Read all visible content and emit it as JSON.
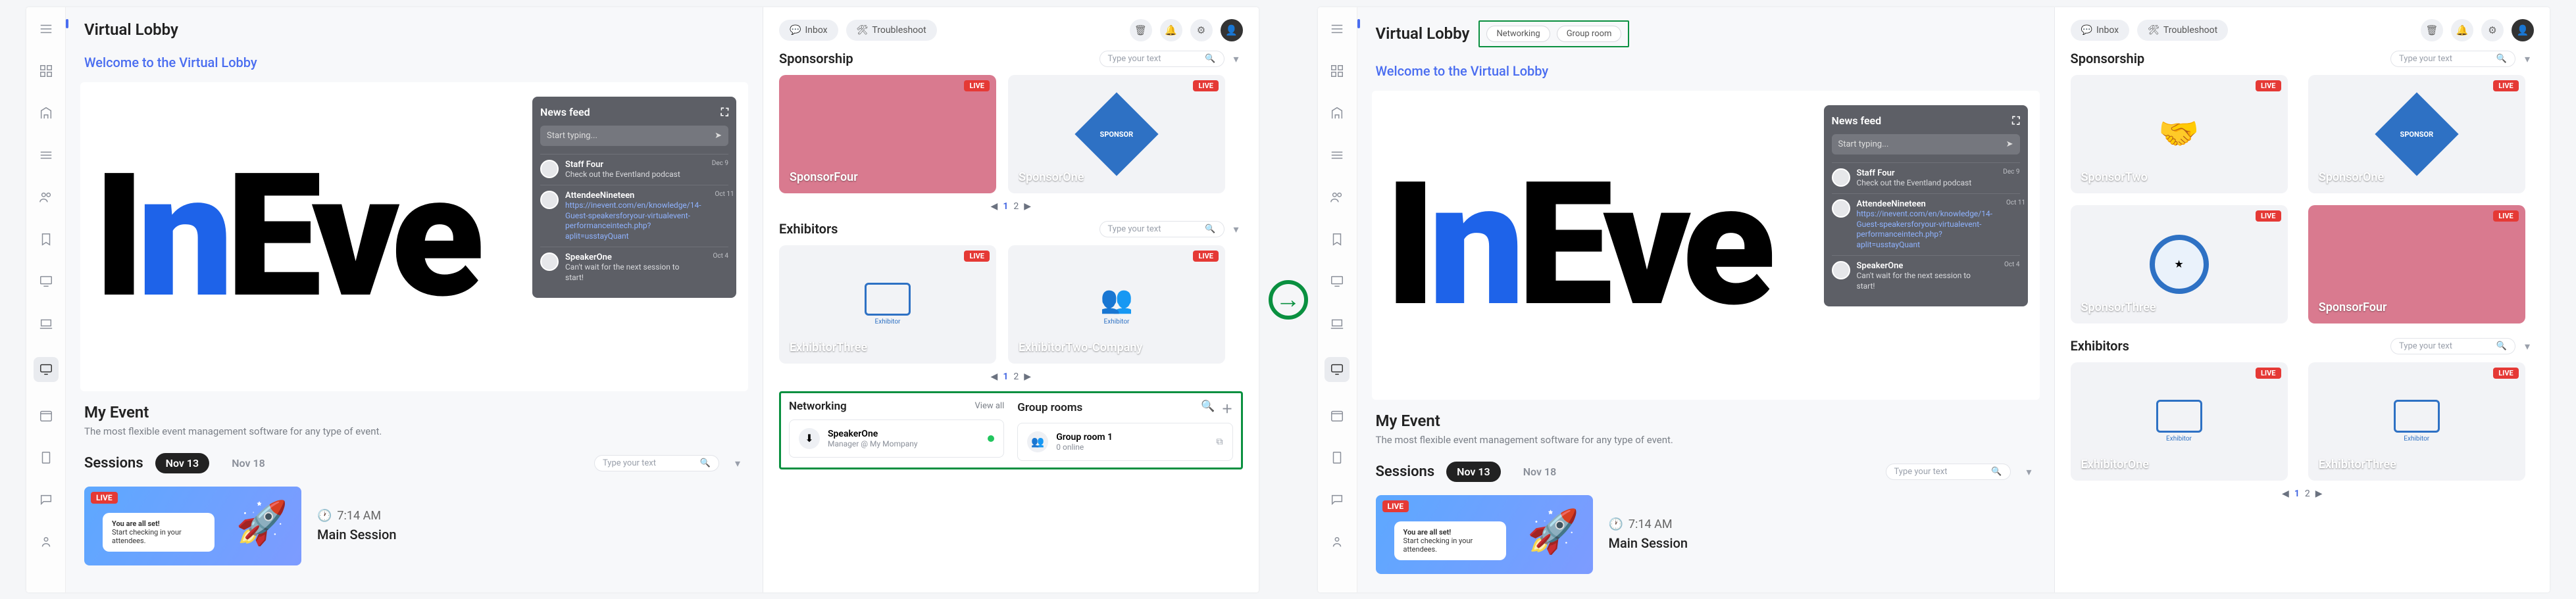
{
  "app": {
    "title": "Virtual Lobby"
  },
  "topbar": {
    "inbox": "Inbox",
    "troubleshoot": "Troubleshoot"
  },
  "nav_tabs": {
    "networking": "Networking",
    "group_room": "Group room"
  },
  "welcome": "Welcome to the Virtual Lobby",
  "newsfeed": {
    "title": "News feed",
    "placeholder": "Start typing...",
    "items": [
      {
        "name": "Staff Four",
        "msg": "Check out the Eventland podcast",
        "date": "Dec 9"
      },
      {
        "name": "AttendeeNineteen",
        "msg": "https://inevent.com/en/knowledge/14-Guest-speakersforyour-virtualevent-performanceintech.php?aplit=usstayQuant",
        "date": "Oct 11",
        "link": true
      },
      {
        "name": "SpeakerOne",
        "msg": "Can't wait for the next session to start!",
        "date": "Oct 4"
      }
    ]
  },
  "event": {
    "name": "My Event",
    "tagline": "The most flexible event management software for any type of event."
  },
  "sessions": {
    "heading": "Sessions",
    "dates": [
      "Nov 13",
      "Nov 18"
    ],
    "search_placeholder": "Type your text",
    "item": {
      "live": "LIVE",
      "speech1": "You are all set!",
      "speech2": "Start checking in your attendees.",
      "time": "7:14 AM",
      "title": "Main Session"
    }
  },
  "sponsorship": {
    "heading": "Sponsorship",
    "search_placeholder": "Type your text",
    "page": {
      "current": "1",
      "other": "2"
    },
    "left_cards": [
      {
        "label": "SponsorFour",
        "live": "LIVE",
        "style": "pink"
      },
      {
        "label": "SponsorOne",
        "live": "LIVE",
        "style": "diamond",
        "diamond_text": "SPONSOR"
      }
    ],
    "right_cards": [
      {
        "label": "SponsorTwo",
        "live": "LIVE",
        "style": "handshake"
      },
      {
        "label": "SponsorOne",
        "live": "LIVE",
        "style": "diamond",
        "diamond_text": "SPONSOR"
      },
      {
        "label": "SponsorThree",
        "live": "LIVE",
        "style": "badge"
      },
      {
        "label": "SponsorFour",
        "live": "LIVE",
        "style": "pink"
      }
    ]
  },
  "exhibitors": {
    "heading": "Exhibitors",
    "search_placeholder": "Type your text",
    "page": {
      "current": "1",
      "other": "2"
    },
    "left_cards": [
      {
        "label": "ExhibitorThree",
        "live": "LIVE",
        "caption": "Exhibitor"
      },
      {
        "label": "ExhibitorTwo-Company",
        "live": "LIVE",
        "caption": "Exhibitor"
      }
    ],
    "right_cards": [
      {
        "label": "ExhibitorOne",
        "live": "LIVE",
        "caption": "Exhibitor"
      },
      {
        "label": "ExhibitorThree",
        "live": "LIVE",
        "caption": "Exhibitor"
      }
    ]
  },
  "networking": {
    "heading": "Networking",
    "view_all": "View all",
    "speaker": {
      "name": "SpeakerOne",
      "role": "Manager @ My Mompany"
    }
  },
  "group_rooms": {
    "heading": "Group rooms",
    "room": {
      "name": "Group room 1",
      "online": "0 online"
    }
  }
}
